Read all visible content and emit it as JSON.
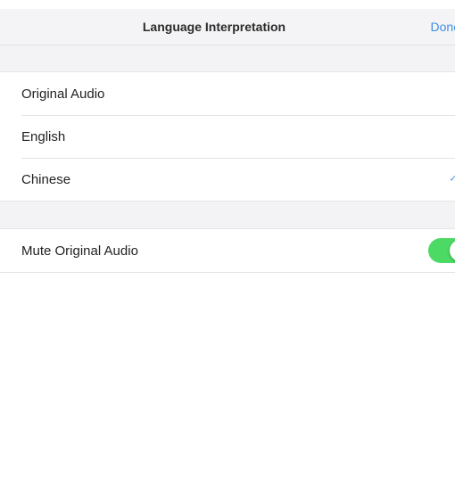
{
  "nav": {
    "title": "Language Interpretation",
    "done_label": "Done"
  },
  "languages": {
    "items": [
      {
        "label": "Original Audio"
      },
      {
        "label": "English"
      },
      {
        "label": "Chinese",
        "selected": true
      }
    ]
  },
  "settings": {
    "mute_label": "Mute Original Audio",
    "mute_enabled": true
  },
  "colors": {
    "accent": "#3e8fe6",
    "toggle_on": "#4cd964",
    "group_background": "#f3f3f5"
  },
  "icons": {
    "selected_indicator": "checkmark-icon"
  }
}
